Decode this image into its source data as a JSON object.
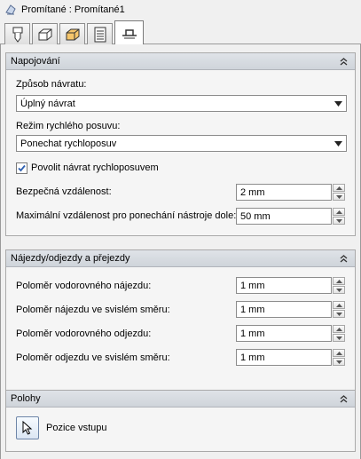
{
  "window": {
    "title": "Promítané : Promítané1"
  },
  "tabs": [
    {
      "name": "tool"
    },
    {
      "name": "shape"
    },
    {
      "name": "layers"
    },
    {
      "name": "list"
    },
    {
      "name": "linking",
      "active": true
    }
  ],
  "section_linking": {
    "title": "Napojování",
    "return_mode_label": "Způsob návratu:",
    "return_mode_value": "Úplný návrat",
    "rapid_mode_label": "Režim rychlého posuvu:",
    "rapid_mode_value": "Ponechat rychloposuv",
    "allow_rapid_return_label": "Povolit návrat rychloposuvem",
    "allow_rapid_return_checked": true,
    "safe_distance_label": "Bezpečná vzdálenost:",
    "safe_distance_value": "2 mm",
    "max_stay_down_label": "Maximální vzdálenost pro ponechání nástroje dole:",
    "max_stay_down_value": "50 mm"
  },
  "section_leads": {
    "title": "Nájezdy/odjezdy a přejezdy",
    "horizontal_lead_in_label": "Poloměr vodorovného nájezdu:",
    "horizontal_lead_in_value": "1 mm",
    "vertical_lead_in_label": "Poloměr nájezdu ve svislém směru:",
    "vertical_lead_in_value": "1 mm",
    "horizontal_lead_out_label": "Poloměr vodorovného odjezdu:",
    "horizontal_lead_out_value": "1 mm",
    "vertical_lead_out_label": "Poloměr odjezdu ve svislém směru:",
    "vertical_lead_out_value": "1 mm"
  },
  "section_positions": {
    "title": "Polohy",
    "entry_position_label": "Pozice vstupu"
  },
  "colors": {
    "panel_header": "#d6dbe1",
    "background": "#f0f0f0",
    "accent_blue": "#2d5fb0"
  }
}
